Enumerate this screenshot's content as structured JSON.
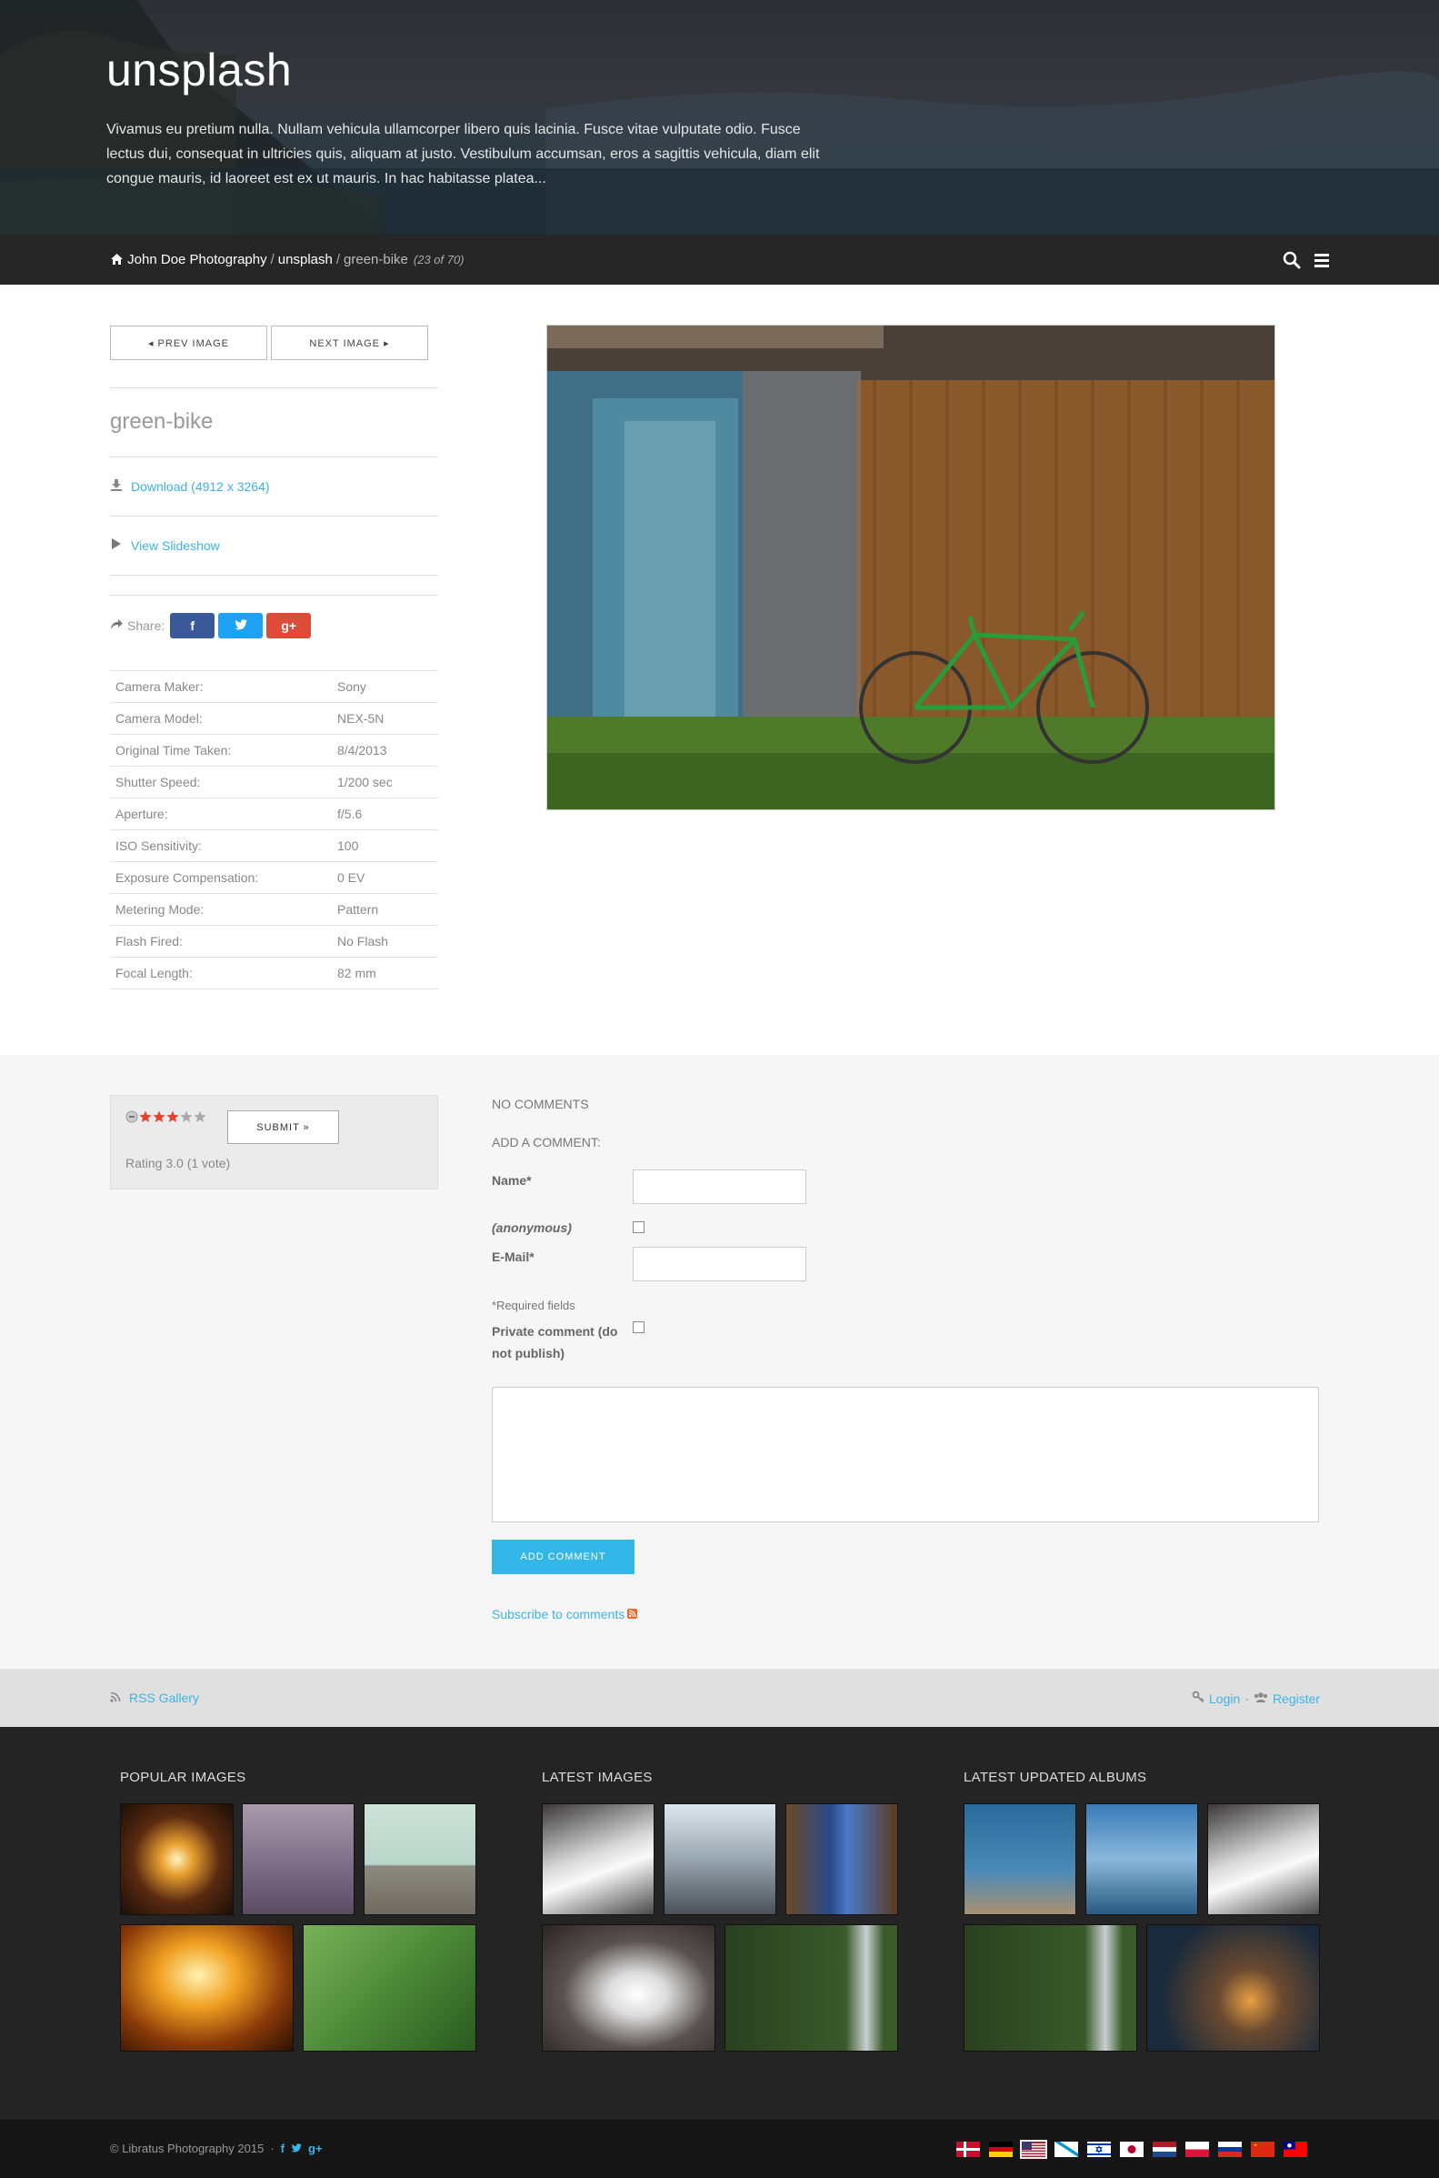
{
  "hero": {
    "title": "unsplash",
    "description": "Vivamus eu pretium nulla. Nullam vehicula ullamcorper libero quis lacinia. Fusce vitae vulputate odio. Fusce lectus dui, consequat in ultricies quis, aliquam at justo. Vestibulum accumsan, eros a sagittis vehicula, diam elit congue mauris, id laoreet est ex ut mauris. In hac habitasse platea..."
  },
  "breadcrumb": {
    "home": "John Doe Photography",
    "sep1": "/",
    "album": "unsplash",
    "sep2": "/",
    "current": "green-bike",
    "count": "(23 of 70)"
  },
  "nav": {
    "prev": "◂ PREV IMAGE",
    "next": "NEXT IMAGE ▸"
  },
  "image": {
    "title": "green-bike",
    "download": "Download (4912 x 3264)",
    "slideshow": "View Slideshow",
    "share_label": "Share:"
  },
  "exif": [
    {
      "label": "Camera Maker:",
      "value": "Sony"
    },
    {
      "label": "Camera Model:",
      "value": "NEX-5N"
    },
    {
      "label": "Original Time Taken:",
      "value": "8/4/2013"
    },
    {
      "label": "Shutter Speed:",
      "value": "1/200 sec"
    },
    {
      "label": "Aperture:",
      "value": "f/5.6"
    },
    {
      "label": "ISO Sensitivity:",
      "value": "100"
    },
    {
      "label": "Exposure Compensation:",
      "value": "0 EV"
    },
    {
      "label": "Metering Mode:",
      "value": "Pattern"
    },
    {
      "label": "Flash Fired:",
      "value": "No Flash"
    },
    {
      "label": "Focal Length:",
      "value": "82 mm"
    }
  ],
  "rating": {
    "stars_filled": 3,
    "stars_total": 5,
    "submit": "SUBMIT »",
    "text": "Rating 3.0 (1 vote)"
  },
  "comments": {
    "none": "NO COMMENTS",
    "add_heading": "ADD A COMMENT:",
    "name_label": "Name*",
    "anon_label": "(anonymous)",
    "email_label": "E-Mail*",
    "required": "*Required fields",
    "private_label": "Private comment (do not publish)",
    "add_button": "ADD COMMENT",
    "subscribe": "Subscribe to comments"
  },
  "rssbar": {
    "rss": "RSS Gallery",
    "login": "Login",
    "sep": "·",
    "register": "Register"
  },
  "footer": {
    "popular": "POPULAR IMAGES",
    "latest": "LATEST IMAGES",
    "albums": "LATEST UPDATED ALBUMS",
    "copyright": "© Libratus Photography 2015",
    "dot": "·"
  },
  "colors": {
    "accent": "#33b7e8",
    "facebook": "#3b5998",
    "twitter": "#1da1f2",
    "googleplus": "#dd4b39",
    "star": "#e8402a"
  }
}
